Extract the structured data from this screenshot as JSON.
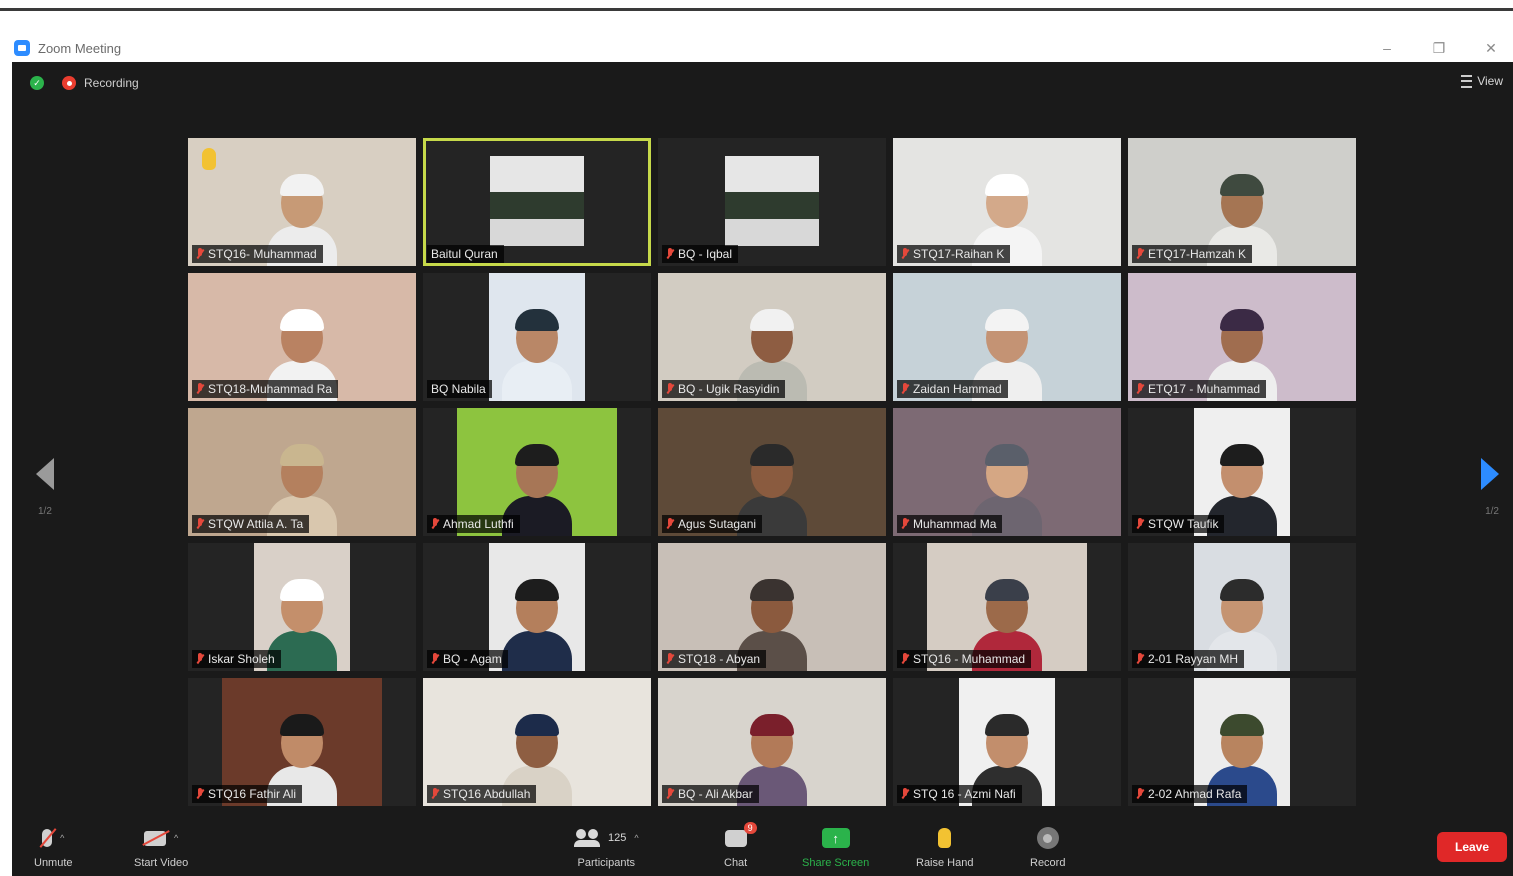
{
  "window": {
    "title": "Zoom Meeting",
    "controls": [
      "minimize",
      "restore",
      "close"
    ]
  },
  "topbar": {
    "recording_label": "Recording",
    "view_label": "View"
  },
  "pagination": {
    "left": "1/2",
    "right": "1/2"
  },
  "participants": [
    {
      "name": "STQ16- Muhammad",
      "muted": true,
      "raised_hand": true,
      "bg": "#d8cfc2",
      "skin": "#c79a76",
      "cap": "#f2f2f2",
      "shirt": "#ececec",
      "layout": "full"
    },
    {
      "name": "Baitul Quran",
      "muted": false,
      "active": true,
      "bg": "#1f1f1f",
      "layout": "poster"
    },
    {
      "name": "BQ - Iqbal",
      "muted": true,
      "bg": "#1f1f1f",
      "layout": "poster"
    },
    {
      "name": "STQ17-Raihan K",
      "muted": true,
      "bg": "#e4e4e2",
      "skin": "#d3a98a",
      "cap": "#ffffff",
      "shirt": "#f4f4f4",
      "layout": "full"
    },
    {
      "name": "ETQ17-Hamzah K",
      "muted": true,
      "bg": "#cfcfcb",
      "skin": "#a57553",
      "cap": "#3f4a3f",
      "shirt": "#e9e9e6",
      "layout": "full"
    },
    {
      "name": "STQ18-Muhammad Ra",
      "muted": true,
      "bg": "#d7b9a8",
      "skin": "#b98262",
      "cap": "#ffffff",
      "shirt": "#f2f2f2",
      "layout": "full"
    },
    {
      "name": "BQ Nabila",
      "muted": false,
      "bg": "#dfe6ee",
      "skin": "#b98767",
      "cap": "#23313c",
      "shirt": "#e8eef4",
      "layout": "narrow"
    },
    {
      "name": "BQ - Ugik Rasyidin",
      "muted": true,
      "bg": "#d2ccc2",
      "skin": "#8e5d42",
      "cap": "#f1f1f1",
      "shirt": "#bbbbb2",
      "layout": "full"
    },
    {
      "name": "Zaidan Hammad",
      "muted": true,
      "bg": "#c6d2d8",
      "skin": "#c49374",
      "cap": "#f3f3f3",
      "shirt": "#efefef",
      "layout": "full"
    },
    {
      "name": "ETQ17 - Muhammad",
      "muted": true,
      "bg": "#cdbccb",
      "skin": "#a06d4f",
      "cap": "#3b2a45",
      "shirt": "#eeeeee",
      "layout": "full"
    },
    {
      "name": "STQW Attila A. Ta",
      "muted": true,
      "bg": "#bfa78f",
      "skin": "#b4805e",
      "cap": "#c9b68f",
      "shirt": "#d9c7ae",
      "layout": "full"
    },
    {
      "name": "Ahmad Luthfi",
      "muted": true,
      "bg": "#8dc43f",
      "skin": "#a77656",
      "cap": "#1d1d1d",
      "shirt": "#1b1b24",
      "layout": "mid"
    },
    {
      "name": "Agus Sutagani",
      "muted": true,
      "bg": "#5e4a38",
      "skin": "#8a5b3f",
      "cap": "#2a2a2a",
      "shirt": "#3a3a3a",
      "layout": "full"
    },
    {
      "name": "Muhammad Ma",
      "muted": true,
      "bg": "#7d6a74",
      "skin": "#d5a784",
      "cap": "#5a5f6a",
      "shirt": "#6d6570",
      "layout": "full"
    },
    {
      "name": "STQW Taufik",
      "muted": true,
      "bg": "#efefef",
      "skin": "#c38f6e",
      "cap": "#1d1d1d",
      "shirt": "#23262d",
      "layout": "narrow"
    },
    {
      "name": "Iskar Sholeh",
      "muted": true,
      "bg": "#d9d0c8",
      "skin": "#c48f6b",
      "cap": "#ffffff",
      "shirt": "#2c6b52",
      "layout": "narrow"
    },
    {
      "name": "BQ - Agam",
      "muted": true,
      "bg": "#e8e8e8",
      "skin": "#b47f5c",
      "cap": "#1d1d1d",
      "shirt": "#1f2d4a",
      "layout": "narrow"
    },
    {
      "name": "STQ18 - Abyan",
      "muted": true,
      "bg": "#c8bfb7",
      "skin": "#8b5a3e",
      "cap": "#3a3330",
      "shirt": "#5b4f48",
      "layout": "full"
    },
    {
      "name": "STQ16 - Muhammad",
      "muted": true,
      "bg": "#d5ccc3",
      "skin": "#9c6a4a",
      "cap": "#3a3f4a",
      "shirt": "#b0283b",
      "layout": "mid"
    },
    {
      "name": "2-01 Rayyan MH",
      "muted": true,
      "bg": "#d9dde2",
      "skin": "#c59472",
      "cap": "#2c2c2c",
      "shirt": "#e3e6ea",
      "layout": "narrow"
    },
    {
      "name": "STQ16 Fathir Ali",
      "muted": true,
      "bg": "#6b3a2a",
      "skin": "#c08b68",
      "cap": "#1a1a1a",
      "shirt": "#e8e8e8",
      "layout": "mid"
    },
    {
      "name": "STQ16 Abdullah",
      "muted": true,
      "bg": "#e8e4dd",
      "skin": "#8e5e42",
      "cap": "#1c2b4a",
      "shirt": "#d9d2c6",
      "layout": "full"
    },
    {
      "name": "BQ - Ali Akbar",
      "muted": true,
      "bg": "#d8d4cd",
      "skin": "#b27a58",
      "cap": "#7a1f2b",
      "shirt": "#6a5877",
      "layout": "full"
    },
    {
      "name": "STQ 16 - Azmi Nafi",
      "muted": true,
      "bg": "#f0f0f0",
      "skin": "#c28e6c",
      "cap": "#2a2a2a",
      "shirt": "#2e2e2e",
      "layout": "narrow"
    },
    {
      "name": "2-02 Ahmad Rafa",
      "muted": true,
      "bg": "#ececec",
      "skin": "#b8845f",
      "cap": "#3c4a2e",
      "shirt": "#2b4a8c",
      "layout": "narrow"
    }
  ],
  "toolbar": {
    "unmute": "Unmute",
    "start_video": "Start Video",
    "participants": "Participants",
    "participants_count": "125",
    "chat": "Chat",
    "chat_badge": "9",
    "share_screen": "Share Screen",
    "raise_hand": "Raise Hand",
    "record": "Record",
    "leave": "Leave"
  }
}
